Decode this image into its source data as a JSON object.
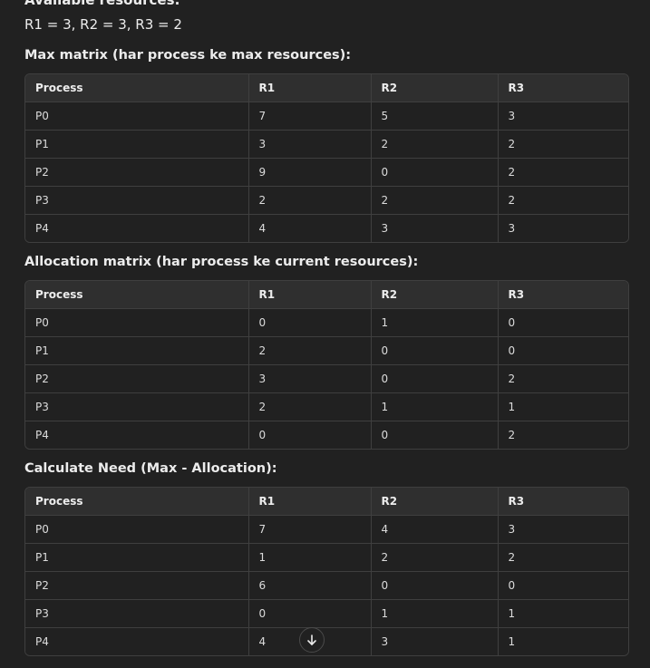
{
  "intro": {
    "heading": "Available resources:",
    "resources_line": "R1 = 3, R2 = 3, R3 = 2"
  },
  "tables": [
    {
      "heading": "Max matrix (har process ke max resources):",
      "columns": [
        "Process",
        "R1",
        "R2",
        "R3"
      ],
      "rows": [
        [
          "P0",
          "7",
          "5",
          "3"
        ],
        [
          "P1",
          "3",
          "2",
          "2"
        ],
        [
          "P2",
          "9",
          "0",
          "2"
        ],
        [
          "P3",
          "2",
          "2",
          "2"
        ],
        [
          "P4",
          "4",
          "3",
          "3"
        ]
      ]
    },
    {
      "heading": "Allocation matrix (har process ke current resources):",
      "columns": [
        "Process",
        "R1",
        "R2",
        "R3"
      ],
      "rows": [
        [
          "P0",
          "0",
          "1",
          "0"
        ],
        [
          "P1",
          "2",
          "0",
          "0"
        ],
        [
          "P2",
          "3",
          "0",
          "2"
        ],
        [
          "P3",
          "2",
          "1",
          "1"
        ],
        [
          "P4",
          "0",
          "0",
          "2"
        ]
      ]
    },
    {
      "heading": "Calculate Need (Max - Allocation):",
      "columns": [
        "Process",
        "R1",
        "R2",
        "R3"
      ],
      "rows": [
        [
          "P0",
          "7",
          "4",
          "3"
        ],
        [
          "P1",
          "1",
          "2",
          "2"
        ],
        [
          "P2",
          "6",
          "0",
          "0"
        ],
        [
          "P3",
          "0",
          "1",
          "1"
        ],
        [
          "P4",
          "4",
          "3",
          "1"
        ]
      ]
    }
  ],
  "scroll_button": {
    "icon": "arrow-down-icon"
  }
}
